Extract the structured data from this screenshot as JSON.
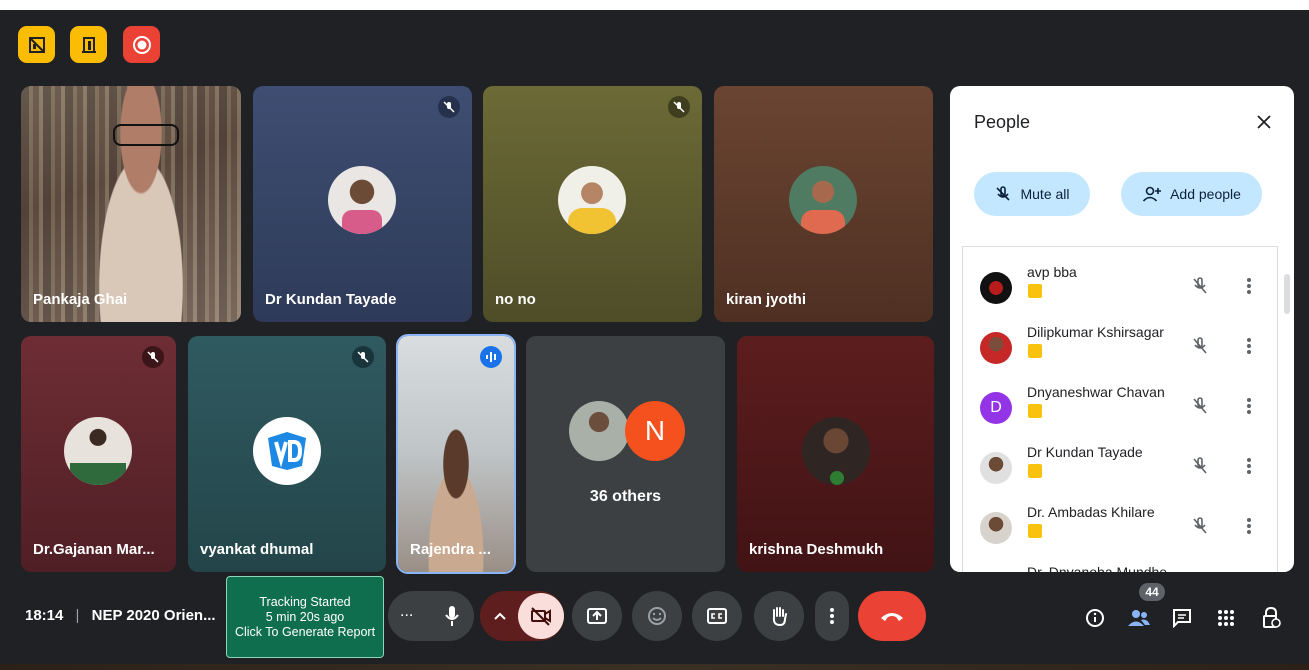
{
  "top_badges": [
    {
      "name": "host-controls-badge",
      "color": "#fbbc04"
    },
    {
      "name": "breakout-badge",
      "color": "#fbbc04"
    },
    {
      "name": "recording-badge",
      "color": "#ea4335"
    }
  ],
  "tiles": [
    {
      "name": "Pankaja Ghai"
    },
    {
      "name": "Dr Kundan Tayade"
    },
    {
      "name": "no no"
    },
    {
      "name": "kiran jyothi"
    },
    {
      "name": "Dr.Gajanan Mar..."
    },
    {
      "name": "vyankat dhumal"
    },
    {
      "name": "Rajendra ..."
    },
    {
      "name": "36 others",
      "initial": "N"
    },
    {
      "name": "krishna Deshmukh"
    }
  ],
  "people_panel": {
    "title": "People",
    "mute_all": "Mute all",
    "add_people": "Add people",
    "participants": [
      {
        "name": "avp bba"
      },
      {
        "name": "Dilipkumar Kshirsagar"
      },
      {
        "name": "Dnyaneshwar Chavan",
        "initial": "D"
      },
      {
        "name": "Dr Kundan Tayade"
      },
      {
        "name": "Dr. Ambadas Khilare"
      },
      {
        "name": "Dr. Dnyanoba Mundhe"
      }
    ]
  },
  "bottom_bar": {
    "time": "18:14",
    "separator": "|",
    "meeting_title": "NEP 2020 Orien...",
    "tracking": {
      "line1": "Tracking Started",
      "line2": "5 min 20s ago",
      "line3": "Click To Generate Report"
    },
    "more_options_dots": "...",
    "participant_count": "44"
  },
  "colors": {
    "background": "#202124",
    "accent_blue": "#c2e7ff",
    "hangup_red": "#ea4335",
    "tracking_green": "#0f6e4e",
    "highlight_tag": "#f9c20f"
  }
}
